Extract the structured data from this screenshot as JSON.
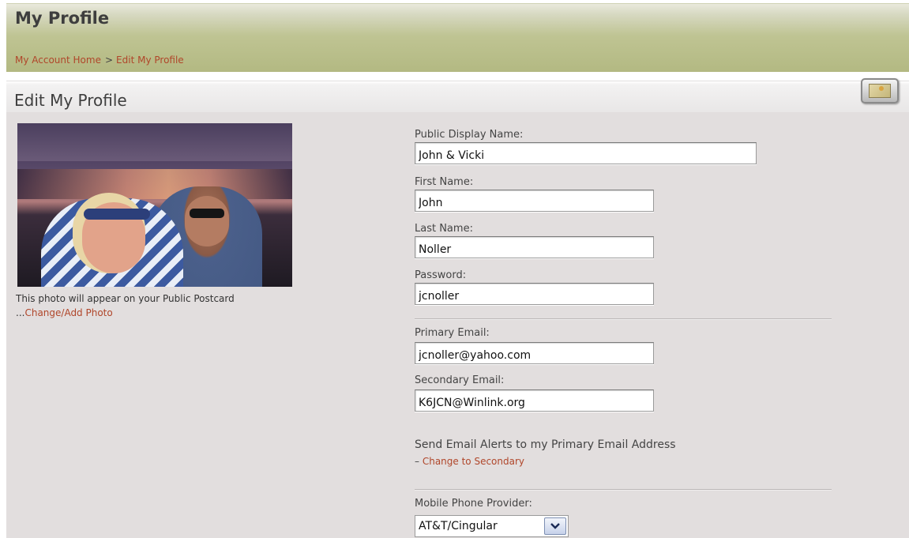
{
  "header": {
    "title": "My Profile",
    "breadcrumb": {
      "home": "My Account Home",
      "separator": ">",
      "current": "Edit My Profile"
    }
  },
  "section": {
    "title": "Edit My Profile",
    "icon": "map-icon"
  },
  "photo": {
    "caption": "This photo will appear on your Public Postcard ...",
    "change_link": "Change/Add Photo"
  },
  "form": {
    "display_name": {
      "label": "Public Display Name:",
      "value": "John & Vicki"
    },
    "first_name": {
      "label": "First Name:",
      "value": "John"
    },
    "last_name": {
      "label": "Last Name:",
      "value": "Noller"
    },
    "password": {
      "label": "Password:",
      "value": "jcnoller"
    },
    "primary_email": {
      "label": "Primary Email:",
      "value": "jcnoller@yahoo.com"
    },
    "secondary_email": {
      "label": "Secondary Email:",
      "value": "K6JCN@Winlink.org"
    },
    "alerts": {
      "text": "Send Email Alerts to my Primary Email Address",
      "prefix": "– ",
      "link": "Change to Secondary"
    },
    "mobile_provider": {
      "label": "Mobile Phone Provider:",
      "selected": "AT&T/Cingular"
    }
  },
  "colors": {
    "link": "#b0462a",
    "header_band": "#b3b982",
    "panel": "#e2dede"
  }
}
